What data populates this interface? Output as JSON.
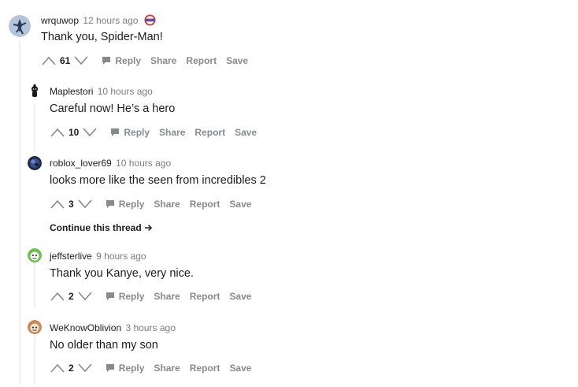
{
  "comments": [
    {
      "username": "wrquwop",
      "time": "12 hours ago",
      "body": "Thank you, Spider-Man!",
      "score": "61",
      "has_award": true
    },
    {
      "username": "Maplestori",
      "time": "10 hours ago",
      "body": "Careful now! He’s a hero",
      "score": "10"
    },
    {
      "username": "roblox_lover69",
      "time": "10 hours ago",
      "body": "looks more like the seen from incredibles 2",
      "score": "3"
    },
    {
      "username": "jeffsterlive",
      "time": "9 hours ago",
      "body": "Thank you Kanye, very nice.",
      "score": "2"
    },
    {
      "username": "WeKnowOblivion",
      "time": "3 hours ago",
      "body": "No older than my son",
      "score": "2"
    }
  ],
  "actions": {
    "reply": "Reply",
    "share": "Share",
    "report": "Report",
    "save": "Save"
  },
  "continue_thread": "Continue this thread",
  "icons": {
    "upvote": "upvote-arrow-icon",
    "downvote": "downvote-arrow-icon",
    "reply": "speech-bubble-icon",
    "continue": "arrow-right-icon",
    "award": "award-icon"
  },
  "colors": {
    "text": "#1c1c1c",
    "muted": "#878a8c",
    "time": "#7c7c7c",
    "thread_line": "#edeff1"
  }
}
